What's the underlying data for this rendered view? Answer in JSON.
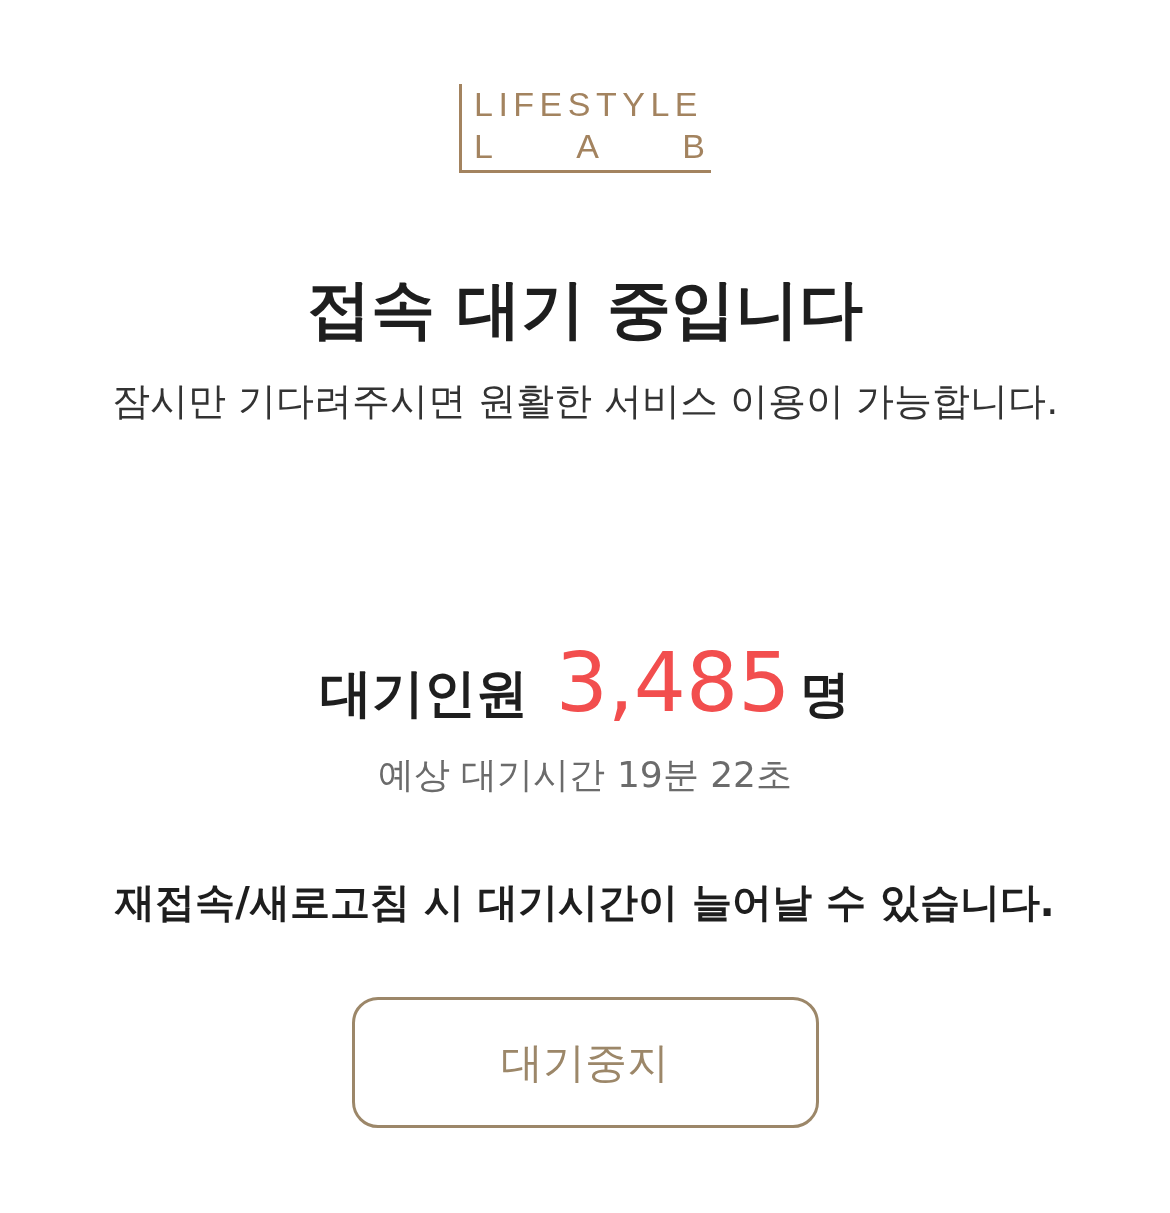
{
  "logo": {
    "top_line": "LIFESTYLE",
    "bottom_letters": [
      "L",
      "A",
      "B"
    ]
  },
  "heading": "접속 대기 중입니다",
  "subtitle": "잠시만 기다려주시면 원활한 서비스 이용이 가능합니다.",
  "queue": {
    "label": "대기인원",
    "count": "3,485",
    "unit": "명",
    "estimate": "예상 대기시간 19분 22초"
  },
  "notice": "재접속/새로고침 시 대기시간이 늘어날 수 있습니다.",
  "button": {
    "label": "대기중지"
  }
}
